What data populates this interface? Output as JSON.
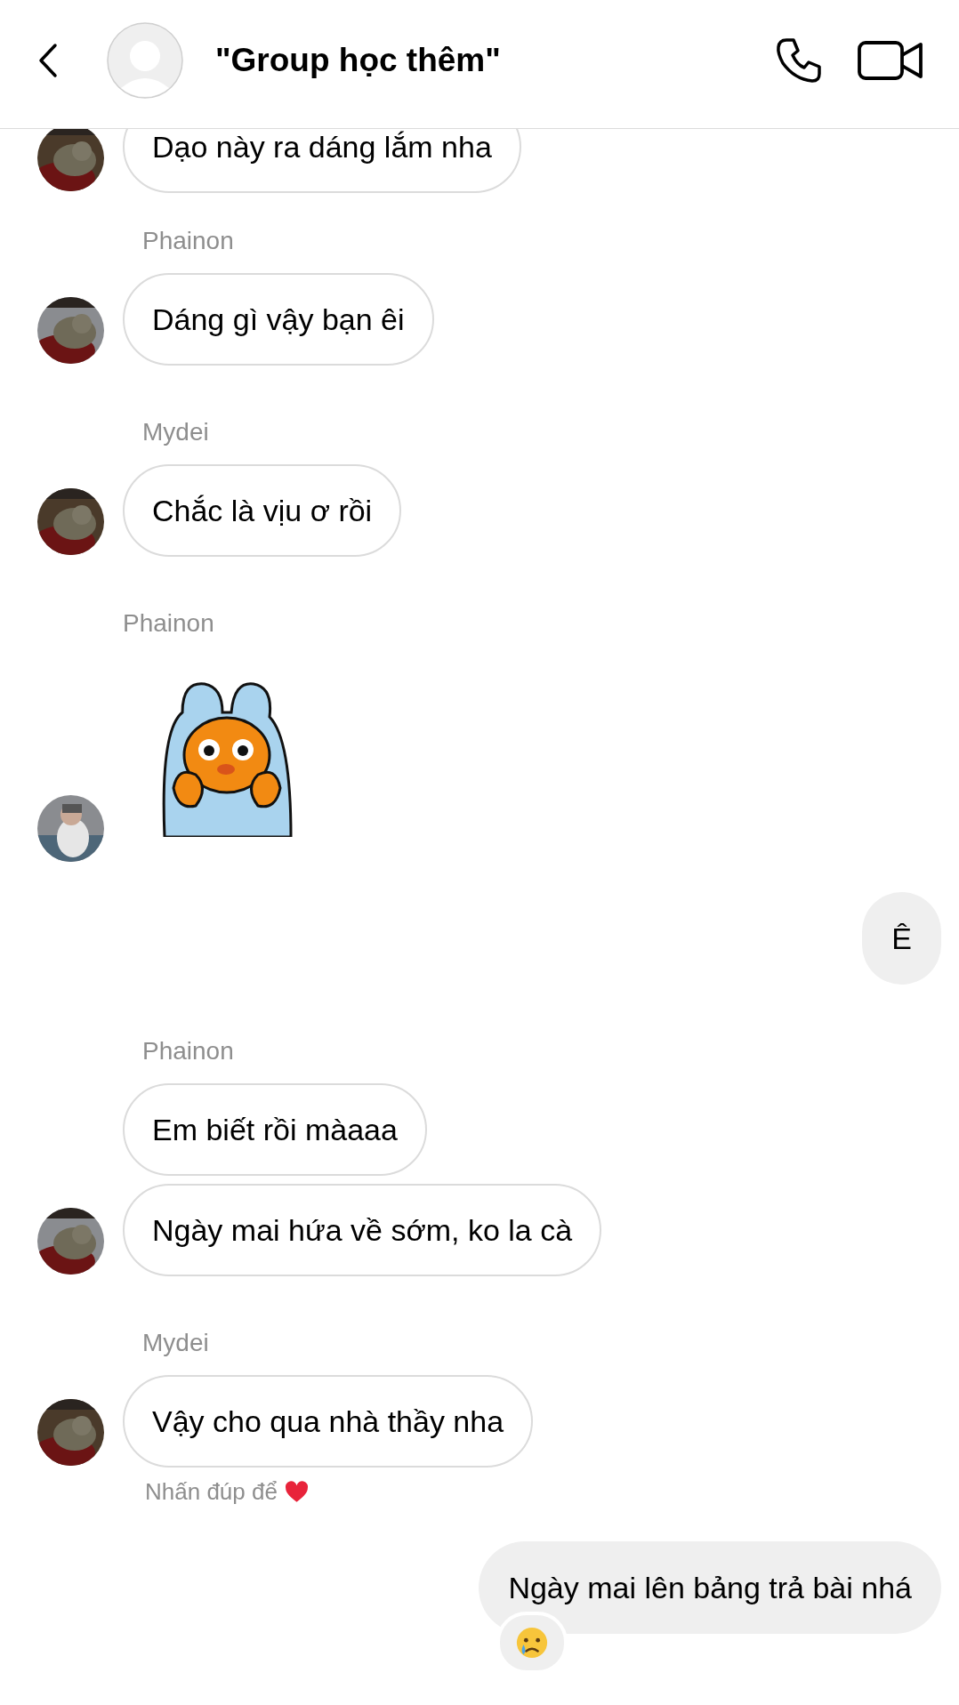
{
  "header": {
    "title": "\"Group học thêm\""
  },
  "messages": [
    {
      "kind": "in",
      "text": "Dạo này ra dáng lắm nha"
    },
    {
      "kind": "name",
      "text": "Phainon"
    },
    {
      "kind": "in",
      "text": "Dáng gì vậy bạn êi"
    },
    {
      "kind": "name",
      "text": "Mydei"
    },
    {
      "kind": "in",
      "text": "Chắc là vịu ơ rồi"
    },
    {
      "kind": "sticker_name",
      "text": "Phainon"
    },
    {
      "kind": "sticker"
    },
    {
      "kind": "out",
      "text": "Ê"
    },
    {
      "kind": "name",
      "text": "Phainon"
    },
    {
      "kind": "in",
      "text": "Em biết rồi màaaa"
    },
    {
      "kind": "in",
      "text": "Ngày mai hứa về sớm, ko la cà"
    },
    {
      "kind": "name",
      "text": "Mydei"
    },
    {
      "kind": "in",
      "text": "Vậy cho qua nhà thầy nha"
    },
    {
      "kind": "hint",
      "text": "Nhấn đúp để"
    },
    {
      "kind": "out",
      "text": "Ngày mai lên bảng trả bài nhá",
      "reaction": {
        "kind": "crying"
      }
    }
  ]
}
